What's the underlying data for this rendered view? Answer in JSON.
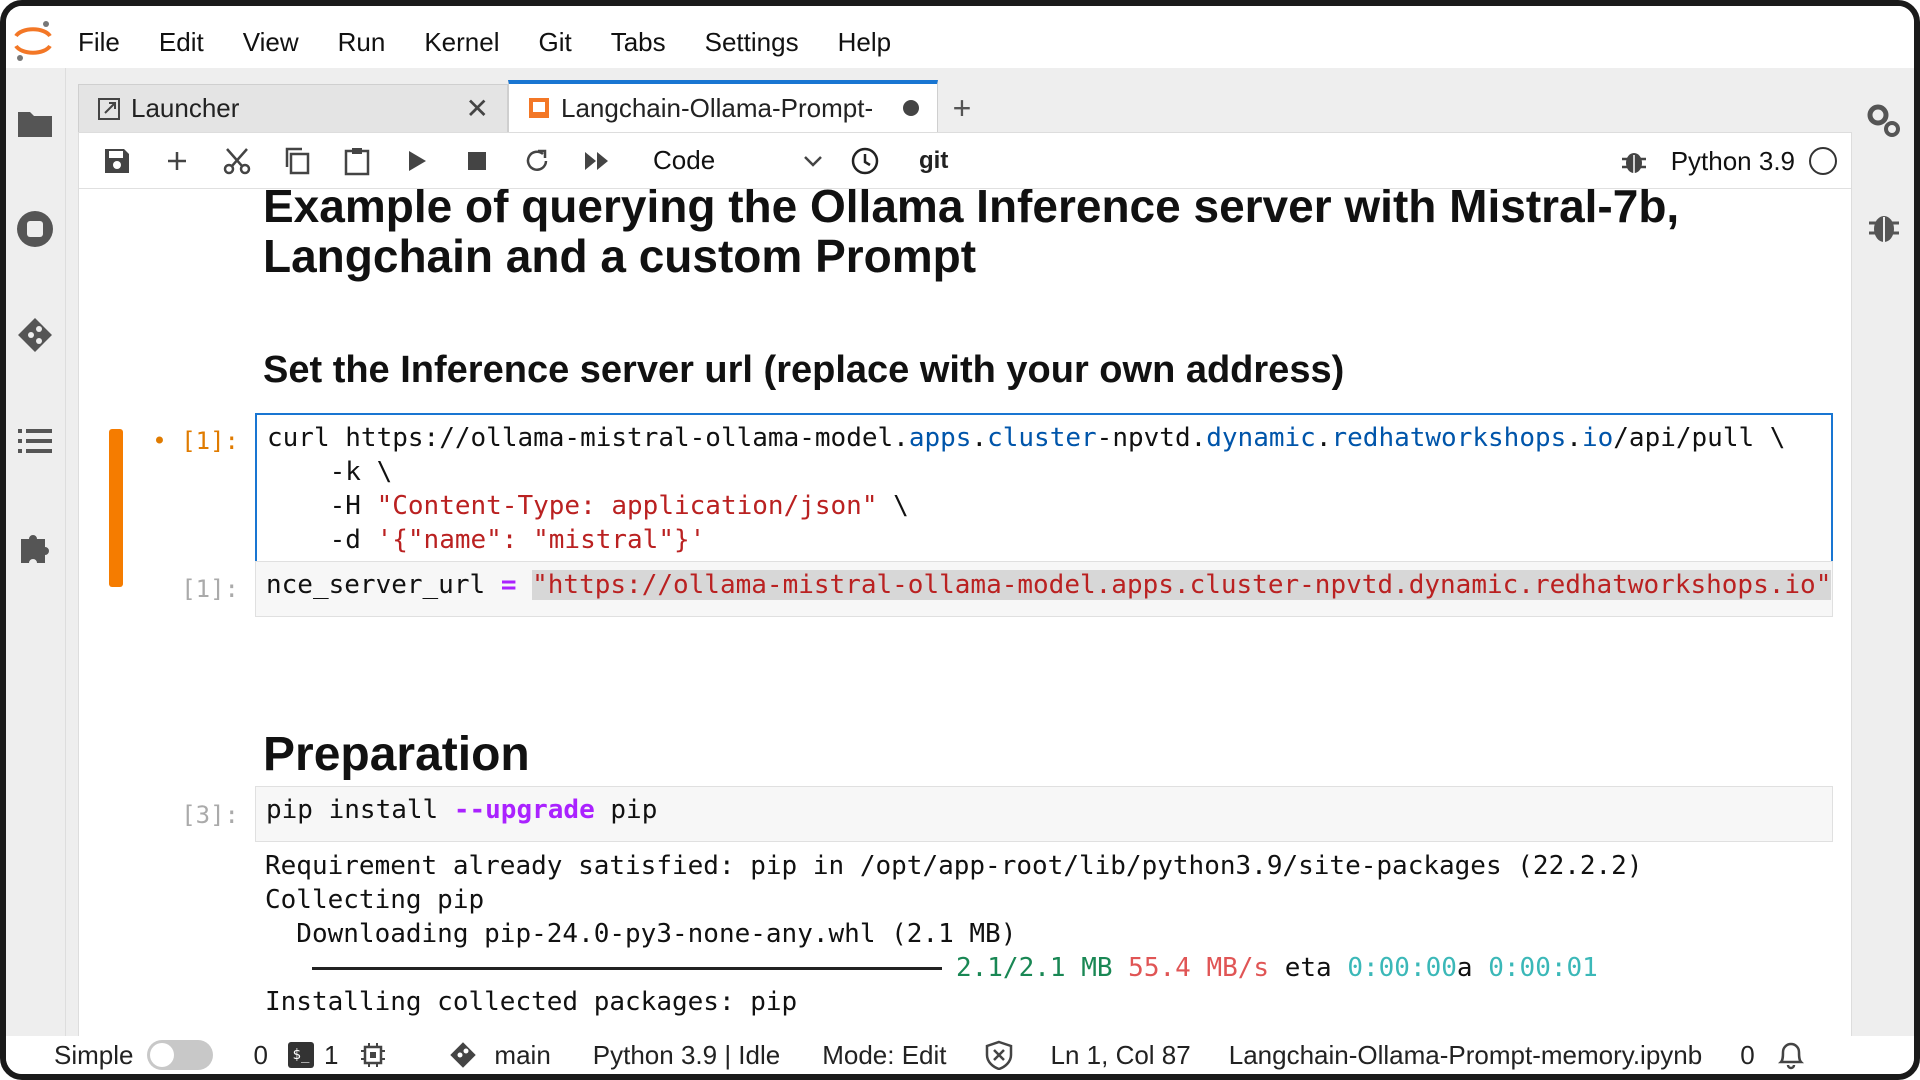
{
  "menu": [
    "File",
    "Edit",
    "View",
    "Run",
    "Kernel",
    "Git",
    "Tabs",
    "Settings",
    "Help"
  ],
  "tabs": {
    "launcher": "Launcher",
    "notebook": "Langchain-Ollama-Prompt-"
  },
  "toolbar": {
    "cell_type": "Code",
    "git_label": "git",
    "kernel": "Python 3.9"
  },
  "notebook": {
    "title": "Example of querying the Ollama Inference server with Mistral-7b, Langchain and a custom Prompt",
    "heading_set_url": "Set the Inference server url (replace with your own address)",
    "heading_preparation": "Preparation",
    "cells": [
      {
        "prompt": "• [1]:",
        "line1_cmd": "curl ",
        "line1_a": "https:",
        "line1_b": "//ollama-mistral-ollama-model.",
        "line1_c": "apps",
        "line1_d": ".",
        "line1_e": "cluster",
        "line1_f": "-npvtd.",
        "line1_g": "dynamic",
        "line1_h": ".",
        "line1_i": "redhatworkshops",
        "line1_j": ".",
        "line1_k": "io",
        "line1_l": "/api/pull \\",
        "line2": "    -k \\",
        "line3_flag": "    -H ",
        "line3_str": "\"Content-Type: application/json\"",
        "line3_end": " \\",
        "line4_flag": "    -d ",
        "line4_str": "'{\"name\": \"mistral\"}'"
      },
      {
        "prompt": "[1]:",
        "var": "nce_server_url ",
        "eq": "=",
        "value": "\"https://ollama-mistral-ollama-model.apps.cluster-npvtd.dynamic.redhatworkshops.io\""
      },
      {
        "prompt": "[3]:",
        "code_a": "pip install ",
        "code_b": "--upgrade",
        "code_c": " pip",
        "output": {
          "line1": "Requirement already satisfied: pip in /opt/app-root/lib/python3.9/site-packages (22.2.2)",
          "line2": "Collecting pip",
          "line3": "  Downloading pip-24.0-py3-none-any.whl (2.1 MB)",
          "progress_size": "2.1/2.1 MB",
          "progress_speed": "55.4 MB/s",
          "progress_eta_label": "eta",
          "progress_eta": "0:00:00",
          "progress_a": "a",
          "progress_time": "0:00:01",
          "line5": "Installing collected packages: pip"
        }
      }
    ]
  },
  "status": {
    "mode_simple": "Simple",
    "count0": "0",
    "terminal_icon_text": "$_",
    "count1": "1",
    "branch": "main",
    "kernel_status": "Python 3.9 | Idle",
    "mode": "Mode: Edit",
    "cursor": "Ln 1, Col 87",
    "filename": "Langchain-Ollama-Prompt-memory.ipynb",
    "notifications": "0"
  },
  "colors": {
    "accent": "#1976d2",
    "active_cell": "#f57c00"
  }
}
